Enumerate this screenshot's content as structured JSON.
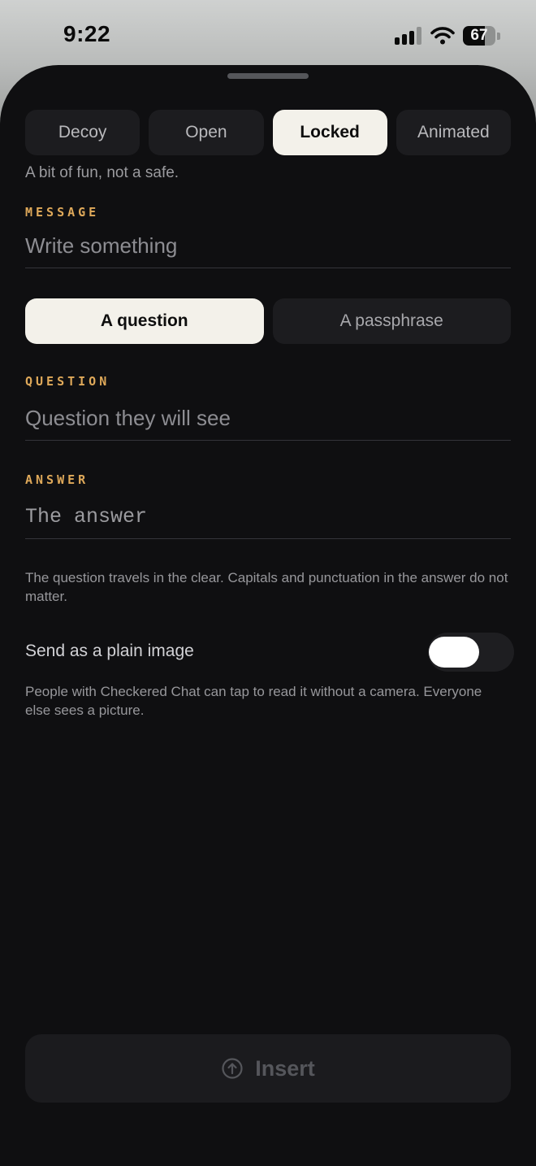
{
  "status_bar": {
    "time": "9:22",
    "battery_percent": "67",
    "battery_level": 0.67
  },
  "modes": {
    "items": [
      {
        "label": "Decoy",
        "active": false
      },
      {
        "label": "Open",
        "active": false
      },
      {
        "label": "Locked",
        "active": true
      },
      {
        "label": "Animated",
        "active": false
      }
    ],
    "description": "A bit of fun, not a safe."
  },
  "message": {
    "label": "MESSAGE",
    "value": "",
    "placeholder": "Write something"
  },
  "secret_kind": {
    "items": [
      {
        "label": "A question",
        "active": true
      },
      {
        "label": "A passphrase",
        "active": false
      }
    ]
  },
  "question": {
    "label": "QUESTION",
    "value": "",
    "placeholder": "Question they will see"
  },
  "answer": {
    "label": "ANSWER",
    "value": "",
    "placeholder": "The answer"
  },
  "answer_hint": "The question travels in the clear. Capitals and punctuation in the answer do not matter.",
  "plain_image": {
    "label": "Send as a plain image",
    "enabled": false,
    "hint": "People with Checkered Chat can tap to read it without a camera. Everyone else sees a picture."
  },
  "insert": {
    "label": "Insert",
    "icon": "arrow-up-circle-icon",
    "enabled": false
  }
}
